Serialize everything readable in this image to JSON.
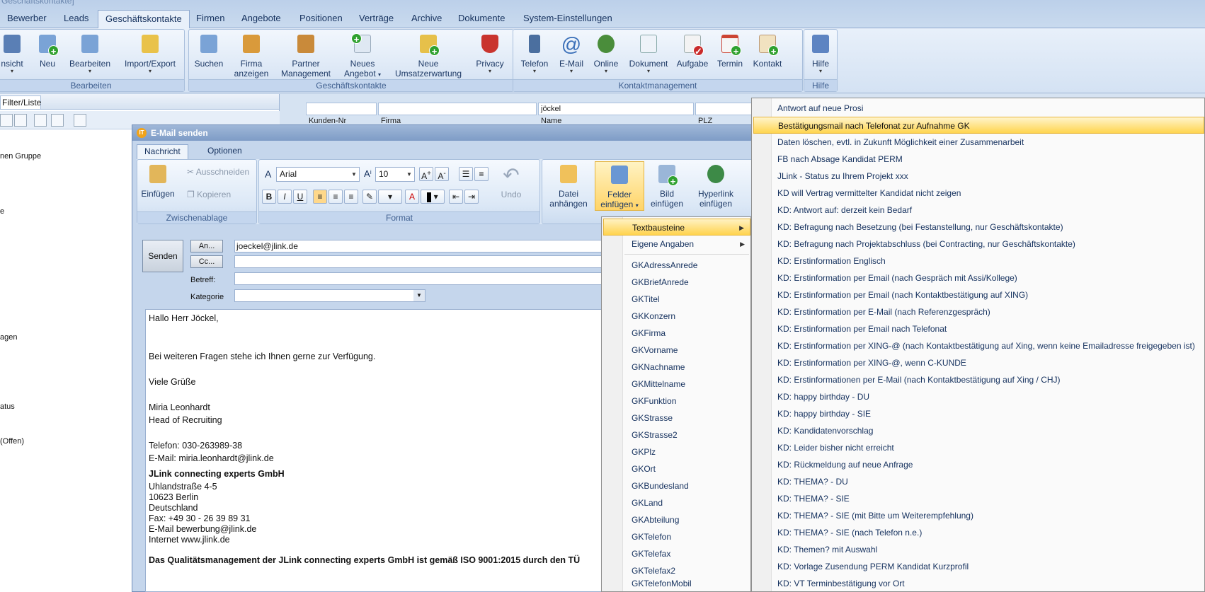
{
  "window": {
    "title": "Geschäftskontakte]"
  },
  "main_tabs": [
    "Bewerber",
    "Leads",
    "Geschäftskontakte",
    "Firmen",
    "Angebote",
    "Positionen",
    "Verträge",
    "Archive",
    "Dokumente",
    "System-Einstellungen"
  ],
  "ribbon": {
    "group_bearbeiten": {
      "label": "Bearbeiten",
      "ansicht": "nsicht",
      "neu": "Neu",
      "bearbeiten": "Bearbeiten",
      "import_export": "Import/Export"
    },
    "group_geschaeftskontakte": {
      "label": "Geschäftskontakte",
      "suchen": "Suchen",
      "firma_1": "Firma",
      "firma_2": "anzeigen",
      "partner_1": "Partner",
      "partner_2": "Management",
      "angebot_1": "Neues",
      "angebot_2": "Angebot",
      "umsatz_1": "Neue",
      "umsatz_2": "Umsatzerwartung",
      "privacy": "Privacy"
    },
    "group_kontakt": {
      "label": "Kontaktmanagement",
      "telefon": "Telefon",
      "email": "E-Mail",
      "online": "Online",
      "dokument": "Dokument",
      "aufgabe": "Aufgabe",
      "termin": "Termin",
      "kontakt": "Kontakt"
    },
    "group_hilfe": {
      "label": "Hilfe",
      "hilfe": "Hilfe"
    }
  },
  "left_panel": {
    "filter_tab": "Filter/Liste",
    "items": [
      "nen Gruppe",
      "e",
      "agen",
      "atus",
      "(Offen)"
    ]
  },
  "grid": {
    "search_value": "jöckel",
    "col1": "Kunden-Nr",
    "col2": "Firma",
    "col3": "Name",
    "col4": "PLZ"
  },
  "dialog": {
    "title": "E-Mail senden",
    "tabs": [
      "Nachricht",
      "Optionen"
    ],
    "clipboard": {
      "label": "Zwischenablage",
      "paste": "Einfügen",
      "cut": "Ausschneiden",
      "copy": "Kopieren"
    },
    "format": {
      "label": "Format",
      "font": "Arial",
      "size": "10",
      "undo": "Undo"
    },
    "insert": {
      "datei_1": "Datei",
      "datei_2": "anhängen",
      "felder_1": "Felder",
      "felder_2": "einfügen",
      "bild_1": "Bild",
      "bild_2": "einfügen",
      "hyperlink_1": "Hyperlink",
      "hyperlink_2": "einfügen"
    },
    "send": "Senden",
    "to_btn": "An...",
    "cc_btn": "Cc...",
    "to_value": "joeckel@jlink.de",
    "subject_label": "Betreff:",
    "category_label": "Kategorie",
    "body": [
      "Hallo Herr Jöckel,",
      "",
      "",
      "Bei weiteren Fragen stehe ich Ihnen gerne zur Verfügung.",
      "",
      "Viele Grüße",
      "",
      "Miria Leonhardt",
      "Head of Recruiting",
      "",
      "Telefon: 030-263989-38",
      "E-Mail: miria.leonhardt@jlink.de"
    ],
    "company": "JLink connecting experts GmbH",
    "address": [
      "Uhlandstraße 4-5",
      "10623 Berlin",
      "Deutschland",
      "Fax: +49 30 - 26 39 89 31",
      "E-Mail bewerbung@jlink.de",
      "Internet www.jlink.de"
    ],
    "footer": "Das Qualitätsmanagement der JLink connecting experts GmbH ist gemäß ISO 9001:2015 durch den TÜ"
  },
  "menu_fields": [
    "Textbausteine",
    "Eigene Angaben",
    "GKAdressAnrede",
    "GKBriefAnrede",
    "GKTitel",
    "GKKonzern",
    "GKFirma",
    "GKVorname",
    "GKNachname",
    "GKMittelname",
    "GKFunktion",
    "GKStrasse",
    "GKStrasse2",
    "GKPlz",
    "GKOrt",
    "GKBundesland",
    "GKLand",
    "GKAbteilung",
    "GKTelefon",
    "GKTelefax",
    "GKTelefax2",
    "GKTelefonMobil"
  ],
  "menu_textbausteine": [
    "Antwort auf neue Prosi",
    "Bestätigungsmail nach Telefonat zur Aufnahme GK",
    "Daten löschen, evtl. in Zukunft Möglichkeit einer Zusammenarbeit",
    "FB nach Absage Kandidat PERM",
    "JLink - Status zu Ihrem Projekt xxx",
    "KD will Vertrag vermittelter Kandidat nicht zeigen",
    "KD: Antwort auf: derzeit kein Bedarf",
    "KD: Befragung nach Besetzung (bei Festanstellung, nur Geschäftskontakte)",
    "KD: Befragung nach Projektabschluss (bei Contracting, nur Geschäftskontakte)",
    "KD: Erstinformation Englisch",
    "KD: Erstinformation per Email (nach Gespräch mit Assi/Kollege)",
    "KD: Erstinformation per Email (nach Kontaktbestätigung auf XING)",
    "KD: Erstinformation per E-Mail (nach Referenzgespräch)",
    "KD: Erstinformation per Email nach Telefonat",
    "KD: Erstinformation per XING-@ (nach Kontaktbestätigung auf Xing, wenn keine Emailadresse freigegeben ist)",
    "KD: Erstinformation per XING-@, wenn C-KUNDE",
    "KD: Erstinformationen per E-Mail (nach Kontaktbestätigung auf Xing / CHJ)",
    "KD: happy birthday - DU",
    "KD: happy birthday - SIE",
    "KD: Kandidatenvorschlag",
    "KD: Leider bisher nicht erreicht",
    "KD: Rückmeldung auf neue Anfrage",
    "KD: THEMA? - DU",
    "KD: THEMA? - SIE",
    "KD: THEMA? - SIE (mit Bitte um Weiterempfehlung)",
    "KD: THEMA? - SIE (nach Telefon n.e.)",
    "KD: Themen? mit Auswahl",
    "KD: Vorlage Zusendung PERM Kandidat Kurzprofil",
    "KD: VT Terminbestätigung vor Ort"
  ],
  "colors": {
    "highlight": "#ffd34e",
    "menu_text": "#15315e",
    "ribbon_bg": "#dce8f6"
  }
}
